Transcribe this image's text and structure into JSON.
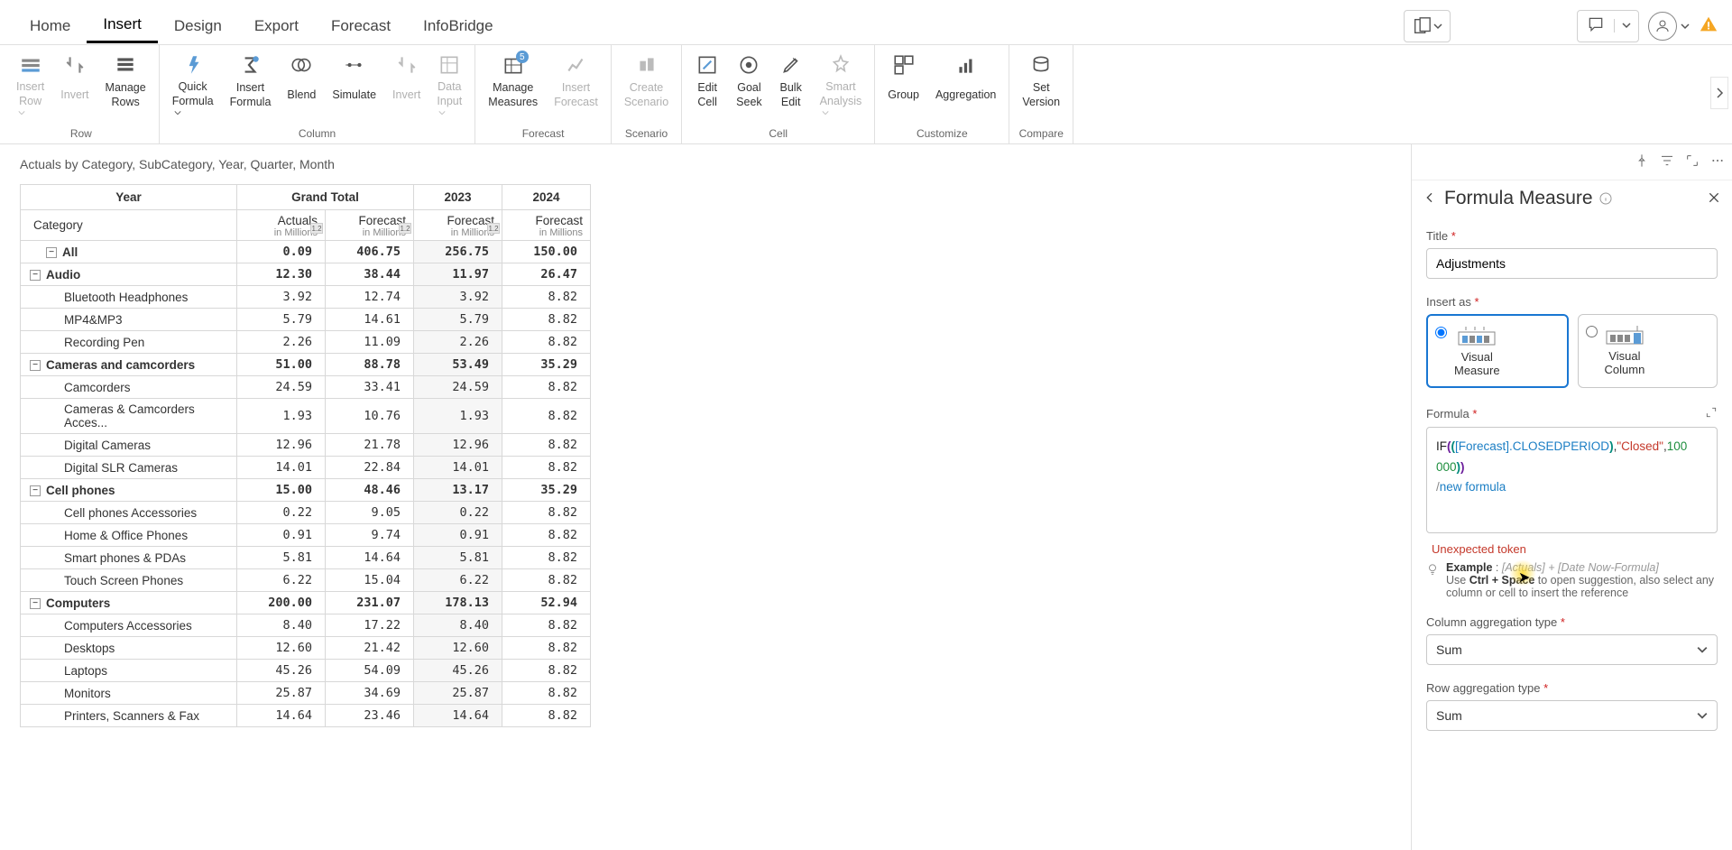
{
  "menu": {
    "tabs": [
      "Home",
      "Insert",
      "Design",
      "Export",
      "Forecast",
      "InfoBridge"
    ],
    "active": 1
  },
  "ribbon": {
    "groups": [
      {
        "label": "Row",
        "items": [
          {
            "label": "Insert\nRow",
            "icon": "insert-row",
            "drop": true,
            "disabled": true
          },
          {
            "label": "Invert",
            "icon": "invert",
            "disabled": true
          },
          {
            "label": "Manage\nRows",
            "icon": "manage-rows"
          }
        ]
      },
      {
        "label": "Column",
        "items": [
          {
            "label": "Quick\nFormula",
            "icon": "quick-formula",
            "drop": true
          },
          {
            "label": "Insert\nFormula",
            "icon": "insert-formula"
          },
          {
            "label": "Blend",
            "icon": "blend"
          },
          {
            "label": "Simulate",
            "icon": "simulate"
          },
          {
            "label": "Invert",
            "icon": "invert-col",
            "disabled": true
          },
          {
            "label": "Data\nInput",
            "icon": "data-input",
            "drop": true,
            "disabled": true
          }
        ]
      },
      {
        "label": "Forecast",
        "items": [
          {
            "label": "Manage\nMeasures",
            "icon": "manage-measures",
            "badge": "5"
          },
          {
            "label": "Insert\nForecast",
            "icon": "insert-forecast",
            "disabled": true
          }
        ]
      },
      {
        "label": "Scenario",
        "items": [
          {
            "label": "Create\nScenario",
            "icon": "create-scenario",
            "disabled": true
          }
        ]
      },
      {
        "label": "Cell",
        "items": [
          {
            "label": "Edit\nCell",
            "icon": "edit-cell"
          },
          {
            "label": "Goal\nSeek",
            "icon": "goal-seek"
          },
          {
            "label": "Bulk\nEdit",
            "icon": "bulk-edit"
          },
          {
            "label": "Smart\nAnalysis",
            "icon": "smart-analysis",
            "drop": true,
            "disabled": true
          }
        ]
      },
      {
        "label": "Customize",
        "items": [
          {
            "label": "Group",
            "icon": "group"
          },
          {
            "label": "Aggregation",
            "icon": "aggregation"
          }
        ]
      },
      {
        "label": "Compare",
        "items": [
          {
            "label": "Set\nVersion",
            "icon": "set-version"
          }
        ]
      }
    ]
  },
  "breadcrumb": "Actuals by Category, SubCategory, Year, Quarter, Month",
  "table": {
    "year_label": "Year",
    "category_label": "Category",
    "grand_total": "Grand Total",
    "periods": [
      "2023",
      "2024"
    ],
    "metric_actuals": "Actuals",
    "metric_forecast": "Forecast",
    "unit": "in Millions",
    "badge": "1.2",
    "rows": [
      {
        "type": "all",
        "label": "All",
        "vals": [
          "0.09",
          "406.75",
          "256.75",
          "150.00"
        ]
      },
      {
        "type": "group",
        "label": "Audio",
        "vals": [
          "12.30",
          "38.44",
          "11.97",
          "26.47"
        ]
      },
      {
        "type": "leaf",
        "label": "Bluetooth Headphones",
        "vals": [
          "3.92",
          "12.74",
          "3.92",
          "8.82"
        ]
      },
      {
        "type": "leaf",
        "label": "MP4&MP3",
        "vals": [
          "5.79",
          "14.61",
          "5.79",
          "8.82"
        ]
      },
      {
        "type": "leaf",
        "label": "Recording Pen",
        "vals": [
          "2.26",
          "11.09",
          "2.26",
          "8.82"
        ]
      },
      {
        "type": "group",
        "label": "Cameras and camcorders",
        "vals": [
          "51.00",
          "88.78",
          "53.49",
          "35.29"
        ]
      },
      {
        "type": "leaf",
        "label": "Camcorders",
        "vals": [
          "24.59",
          "33.41",
          "24.59",
          "8.82"
        ]
      },
      {
        "type": "leaf",
        "label": "Cameras & Camcorders Acces...",
        "vals": [
          "1.93",
          "10.76",
          "1.93",
          "8.82"
        ]
      },
      {
        "type": "leaf",
        "label": "Digital Cameras",
        "vals": [
          "12.96",
          "21.78",
          "12.96",
          "8.82"
        ]
      },
      {
        "type": "leaf",
        "label": "Digital SLR Cameras",
        "vals": [
          "14.01",
          "22.84",
          "14.01",
          "8.82"
        ]
      },
      {
        "type": "group",
        "label": "Cell phones",
        "vals": [
          "15.00",
          "48.46",
          "13.17",
          "35.29"
        ]
      },
      {
        "type": "leaf",
        "label": "Cell phones Accessories",
        "vals": [
          "0.22",
          "9.05",
          "0.22",
          "8.82"
        ]
      },
      {
        "type": "leaf",
        "label": "Home & Office Phones",
        "vals": [
          "0.91",
          "9.74",
          "0.91",
          "8.82"
        ]
      },
      {
        "type": "leaf",
        "label": "Smart phones & PDAs",
        "vals": [
          "5.81",
          "14.64",
          "5.81",
          "8.82"
        ]
      },
      {
        "type": "leaf",
        "label": "Touch Screen Phones",
        "vals": [
          "6.22",
          "15.04",
          "6.22",
          "8.82"
        ]
      },
      {
        "type": "group",
        "label": "Computers",
        "vals": [
          "200.00",
          "231.07",
          "178.13",
          "52.94"
        ]
      },
      {
        "type": "leaf",
        "label": "Computers Accessories",
        "vals": [
          "8.40",
          "17.22",
          "8.40",
          "8.82"
        ]
      },
      {
        "type": "leaf",
        "label": "Desktops",
        "vals": [
          "12.60",
          "21.42",
          "12.60",
          "8.82"
        ]
      },
      {
        "type": "leaf",
        "label": "Laptops",
        "vals": [
          "45.26",
          "54.09",
          "45.26",
          "8.82"
        ]
      },
      {
        "type": "leaf",
        "label": "Monitors",
        "vals": [
          "25.87",
          "34.69",
          "25.87",
          "8.82"
        ]
      },
      {
        "type": "leaf",
        "label": "Printers, Scanners & Fax",
        "vals": [
          "14.64",
          "23.46",
          "14.64",
          "8.82"
        ]
      }
    ]
  },
  "panel": {
    "title": "Formula Measure",
    "title_label": "Title",
    "title_value": "Adjustments",
    "insert_as_label": "Insert as",
    "opt_measure": "Visual\nMeasure",
    "opt_column": "Visual\nColumn",
    "formula_label": "Formula",
    "formula_tokens": {
      "fn": "IF",
      "ref": "[Forecast]",
      "member": ".CLOSEDPERIOD",
      "str": "\"Closed\"",
      "num1": "100",
      "num2": "000",
      "newf": "new formula"
    },
    "error": "Unexpected token",
    "example_label": "Example",
    "example_formula": "[Actuals] + [Date Now-Formula]",
    "example_help1": "Use ",
    "example_kbd": "Ctrl + Space",
    "example_help2": " to open suggestion, also select any column or cell to insert the reference",
    "col_agg_label": "Column aggregation type",
    "col_agg_value": "Sum",
    "row_agg_label": "Row aggregation type",
    "row_agg_value": "Sum"
  }
}
